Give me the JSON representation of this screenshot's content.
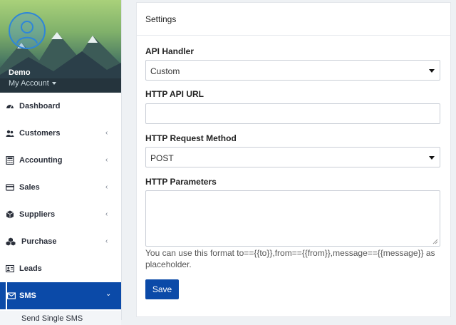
{
  "profile": {
    "name": "Demo",
    "account_label": "My Account"
  },
  "sidebar": {
    "items": [
      {
        "label": "Dashboard",
        "icon": "dashboard-icon",
        "has_chevron": false
      },
      {
        "label": "Customers",
        "icon": "users-icon",
        "has_chevron": true
      },
      {
        "label": "Accounting",
        "icon": "calculator-icon",
        "has_chevron": true
      },
      {
        "label": "Sales",
        "icon": "credit-card-icon",
        "has_chevron": true
      },
      {
        "label": "Suppliers",
        "icon": "cube-icon",
        "has_chevron": true
      },
      {
        "label": "Purchase",
        "icon": "cubes-icon",
        "has_chevron": true
      },
      {
        "label": "Leads",
        "icon": "id-card-icon",
        "has_chevron": false
      },
      {
        "label": "SMS",
        "icon": "envelope-icon",
        "has_chevron": true,
        "active": true
      }
    ],
    "submenu_item": "Send Single SMS"
  },
  "card": {
    "title": "Settings",
    "api_handler": {
      "label": "API Handler",
      "value": "Custom"
    },
    "http_api_url": {
      "label": "HTTP API URL",
      "value": ""
    },
    "http_request_method": {
      "label": "HTTP Request Method",
      "value": "POST"
    },
    "http_parameters": {
      "label": "HTTP Parameters",
      "value": ""
    },
    "help_text": "You can use this format to=={{to}},from=={{from}},message=={{message}} as placeholder.",
    "save_label": "Save"
  },
  "colors": {
    "primary": "#0b4aa8",
    "background": "#eef1f4"
  }
}
